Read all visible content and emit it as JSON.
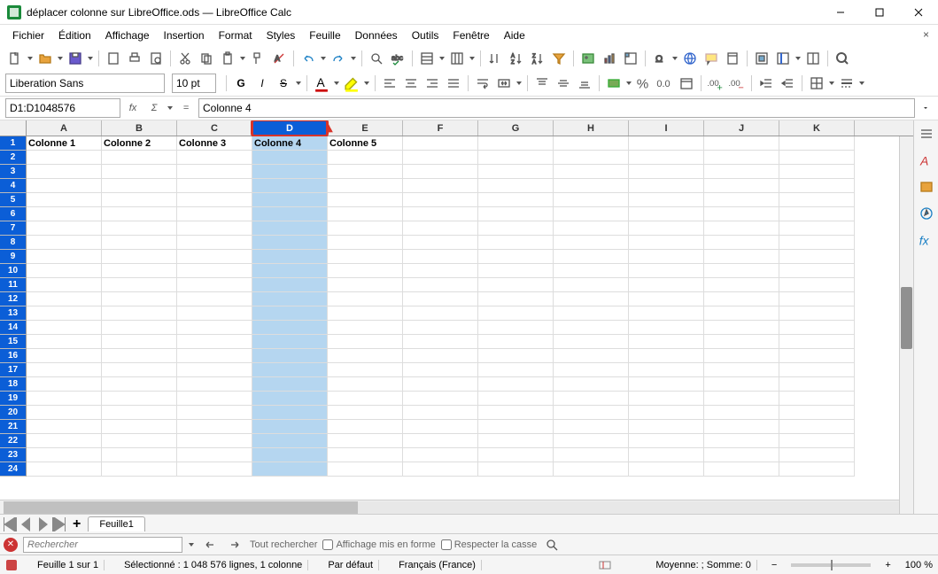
{
  "window": {
    "title": "déplacer colonne sur LibreOffice.ods — LibreOffice Calc"
  },
  "menu": [
    "Fichier",
    "Édition",
    "Affichage",
    "Insertion",
    "Format",
    "Styles",
    "Feuille",
    "Données",
    "Outils",
    "Fenêtre",
    "Aide"
  ],
  "format": {
    "font_name": "Liberation Sans",
    "font_size": "10 pt",
    "bold": "G",
    "italic": "I",
    "underline": "S"
  },
  "formula": {
    "cell_ref": "D1:D1048576",
    "content": "Colonne 4"
  },
  "columns": [
    "A",
    "B",
    "C",
    "D",
    "E",
    "F",
    "G",
    "H",
    "I",
    "J",
    "K"
  ],
  "selected_col_index": 3,
  "row1": [
    "Colonne 1",
    "Colonne 2",
    "Colonne 3",
    "Colonne 4",
    "Colonne 5",
    "",
    "",
    "",
    "",
    "",
    ""
  ],
  "visible_rows": 24,
  "tabs": {
    "sheet": "Feuille1"
  },
  "find": {
    "placeholder": "Rechercher",
    "all": "Tout rechercher",
    "formatted": "Affichage mis en forme",
    "case": "Respecter la casse"
  },
  "status": {
    "sheet_pos": "Feuille 1 sur 1",
    "selection": "Sélectionné : 1 048 576 lignes, 1 colonne",
    "style": "Par défaut",
    "lang": "Français (France)",
    "aggregate": "Moyenne: ; Somme: 0",
    "zoom": "100 %"
  }
}
